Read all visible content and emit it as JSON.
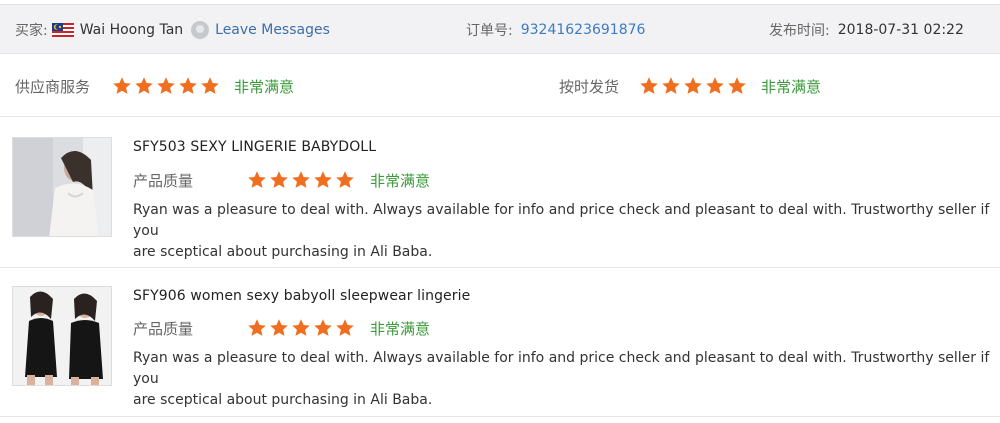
{
  "header": {
    "buyer_label": "买家:",
    "buyer_name": "Wai Hoong Tan",
    "leave_messages": "Leave Messages",
    "order_label": "订单号:",
    "order_number": "93241623691876",
    "published_label": "发布时间:",
    "published_time": "2018-07-31 02:22"
  },
  "service": {
    "supplier_label": "供应商服务",
    "supplier_rating_text": "非常满意",
    "supplier_stars": 5,
    "shipping_label": "按时发货",
    "shipping_rating_text": "非常满意",
    "shipping_stars": 5
  },
  "items": [
    {
      "title": "SFY503 SEXY LINGERIE BABYDOLL",
      "quality_label": "产品质量",
      "rating_text": "非常满意",
      "stars": 5,
      "review_line1": "Ryan was a pleasure to deal with. Always available for info and price check and pleasant to deal with. Trustworthy seller if you",
      "review_line2": "are sceptical about purchasing in Ali Baba."
    },
    {
      "title": "SFY906 women sexy babyoll sleepwear lingerie",
      "quality_label": "产品质量",
      "rating_text": "非常满意",
      "stars": 5,
      "review_line1": "Ryan was a pleasure to deal with. Always available for info and price check and pleasant to deal with. Trustworthy seller if you",
      "review_line2": "are sceptical about purchasing in Ali Baba."
    }
  ],
  "icons": {
    "flag": "malaysia-flag-icon",
    "avatar": "user-avatar-icon",
    "star": "star-icon"
  },
  "colors": {
    "star": "#f06e1f",
    "rating_text": "#3a9a3a",
    "link": "#3d6fa8",
    "order_number": "#3a7cc3",
    "header_bg": "#f2f2f4"
  }
}
